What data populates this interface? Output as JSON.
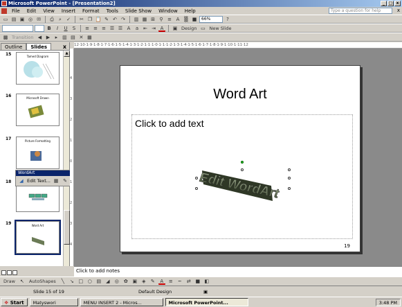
{
  "window": {
    "title": "Microsoft PowerPoint - [Presentation2]",
    "min": "_",
    "max": "□",
    "close": "x"
  },
  "menubar": {
    "items": [
      "File",
      "Edit",
      "View",
      "Insert",
      "Format",
      "Tools",
      "Slide Show",
      "Window",
      "Help"
    ],
    "ask_placeholder": "Type a question for help",
    "close": "x"
  },
  "toolbar": {
    "zoom": "66%",
    "design_label": "Design",
    "new_slide_label": "New Slide",
    "transition_label": "Transition"
  },
  "pane": {
    "tabs": [
      "Outline",
      "Slides"
    ],
    "close": "x",
    "slides": [
      {
        "num": "15",
        "title": "Tamed Diagram"
      },
      {
        "num": "16",
        "title": "Microsoft Drawn"
      },
      {
        "num": "17",
        "title": "Picture Formatting"
      },
      {
        "num": "18",
        "title": ""
      },
      {
        "num": "19",
        "title": "Word Art"
      }
    ]
  },
  "ruler": {
    "top": "12·10·1·9·1·8·1·7·1·6·1·5·1·4·1·3·1·2·1·1·1·0·1·1·1·2·1·3·1·4·1·5·1·6·1·7·1·8·1·9·1·10·1·11·12",
    "side": [
      "4",
      "3",
      "2",
      "1",
      "0",
      "1",
      "2",
      "3",
      "4"
    ]
  },
  "slide": {
    "title": "Word Art",
    "body_placeholder": "Click to add text",
    "wordart_text": "Edit WordArt",
    "number": "19"
  },
  "wordart_toolbar": {
    "title": "WordArt",
    "edit_text": "Edit Text...",
    "close": "x"
  },
  "notes": {
    "placeholder": "Click to add notes"
  },
  "drawbar": {
    "draw": "Draw",
    "autoshapes": "AutoShapes"
  },
  "status": {
    "slide": "Slide 15 of 19",
    "design": "Default Design"
  },
  "taskbar": {
    "start": "Start",
    "tasks": [
      "Matyswori",
      "MENU INSERT 2 - Micros...",
      "Microsoft PowerPoint..."
    ],
    "active_task": 2,
    "clock": "3:48 PM"
  },
  "colors": {
    "titlebar": "#0a246a",
    "workspace": "#8a8a8a",
    "wordart": "#5d6d4a"
  }
}
